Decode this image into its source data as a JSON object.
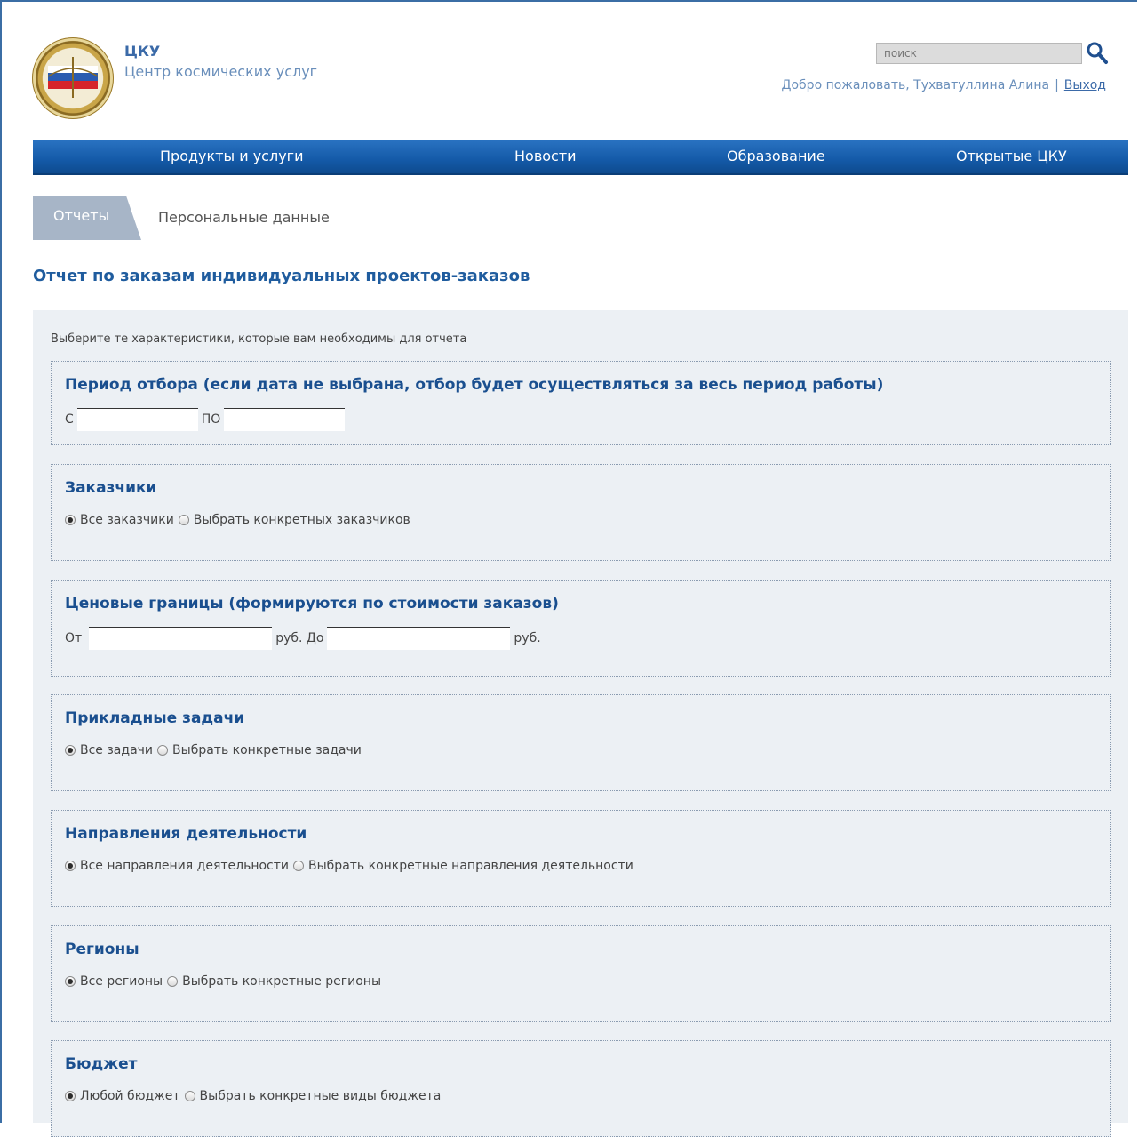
{
  "header": {
    "brand_title": "ЦКУ",
    "brand_subtitle": "Центр космических услуг",
    "search_placeholder": "поиск",
    "welcome_text": "Добро пожаловать, Тухватуллина Алина",
    "separator": "|",
    "logout_label": "Выход"
  },
  "nav": {
    "items": [
      "Продукты и услуги",
      "Новости",
      "Образование",
      "Открытые ЦКУ"
    ]
  },
  "tabs": {
    "active": "Отчеты",
    "inactive": "Персональные данные"
  },
  "page": {
    "title": "Отчет по заказам индивидуальных проектов-заказов",
    "intro": "Выберите те характеристики, которые вам необходимы для отчета"
  },
  "sections": {
    "period": {
      "title": "Период отбора (если дата не выбрана, отбор будет осуществляться за весь период работы)",
      "from_label": "С",
      "to_label": "ПО",
      "from_value": "",
      "to_value": ""
    },
    "customers": {
      "title": "Заказчики",
      "opt_all": "Все заказчики",
      "opt_specific": "Выбрать конкретных заказчиков",
      "selected": "all"
    },
    "price": {
      "title": "Ценовые границы (формируются по стоимости заказов)",
      "from_label": "От",
      "mid_label": "руб. До",
      "end_label": "руб.",
      "from_value": "",
      "to_value": ""
    },
    "tasks": {
      "title": "Прикладные задачи",
      "opt_all": "Все задачи",
      "opt_specific": "Выбрать конкретные задачи",
      "selected": "all"
    },
    "directions": {
      "title": "Направления деятельности",
      "opt_all": "Все направления деятельности",
      "opt_specific": "Выбрать конкретные направления деятельности",
      "selected": "all"
    },
    "regions": {
      "title": "Регионы",
      "opt_all": "Все регионы",
      "opt_specific": "Выбрать конкретные регионы",
      "selected": "all"
    },
    "budget": {
      "title": "Бюджет",
      "opt_all": "Любой бюджет",
      "opt_specific": "Выбрать конкретные виды бюджета",
      "selected": "all"
    }
  },
  "colors": {
    "accent": "#1f5c9e",
    "nav_bg": "#145aa8",
    "panel_bg": "#ecf0f4"
  }
}
